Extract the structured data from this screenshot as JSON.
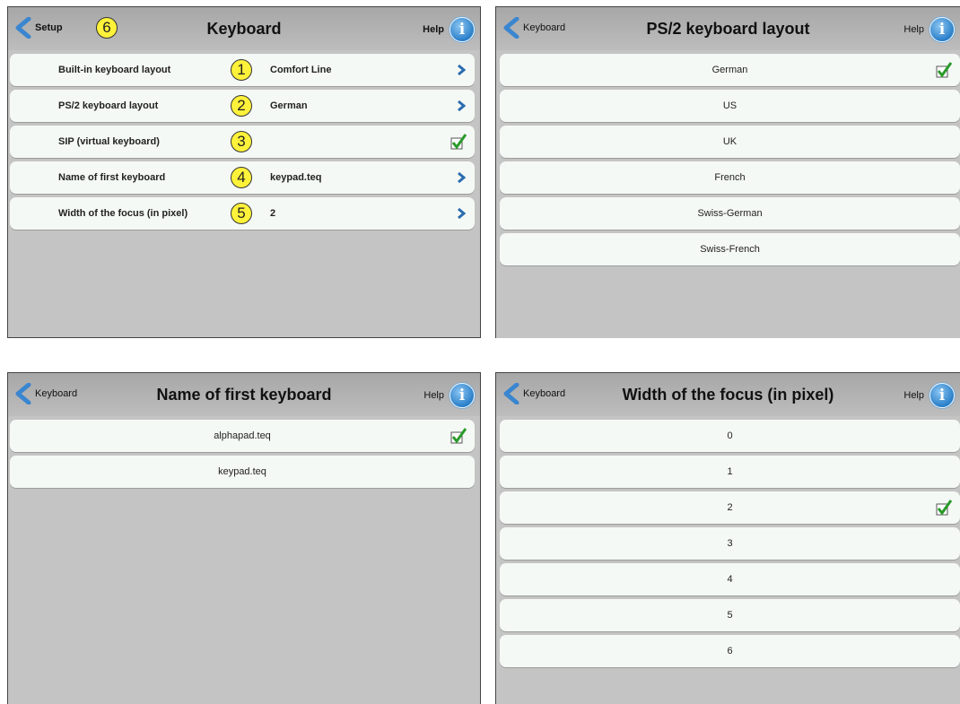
{
  "panel_main": {
    "back_label": "Setup",
    "title": "Keyboard",
    "help_label": "Help",
    "info_glyph": "i",
    "callout_back": "6",
    "rows": [
      {
        "label": "Built-in keyboard layout",
        "value": "Comfort Line",
        "callout": "1",
        "icon": "chevron-right-icon"
      },
      {
        "label": "PS/2 keyboard layout",
        "value": "German",
        "callout": "2",
        "icon": "chevron-right-icon"
      },
      {
        "label": "SIP (virtual keyboard)",
        "value": "",
        "callout": "3",
        "icon": "checkmark-icon"
      },
      {
        "label": "Name of first keyboard",
        "value": "keypad.teq",
        "callout": "4",
        "icon": "chevron-right-icon"
      },
      {
        "label": "Width of the focus (in pixel)",
        "value": "2",
        "callout": "5",
        "icon": "chevron-right-icon"
      }
    ]
  },
  "panel_ps2": {
    "back_label": "Keyboard",
    "title": "PS/2 keyboard layout",
    "help_label": "Help",
    "info_glyph": "i",
    "options": [
      "German",
      "US",
      "UK",
      "French",
      "Swiss-German",
      "Swiss-French"
    ],
    "selected": "German"
  },
  "panel_first": {
    "back_label": "Keyboard",
    "title": "Name of first keyboard",
    "help_label": "Help",
    "info_glyph": "i",
    "options": [
      "alphapad.teq",
      "keypad.teq"
    ],
    "selected": "alphapad.teq"
  },
  "panel_focus": {
    "back_label": "Keyboard",
    "title": "Width of the focus (in pixel)",
    "help_label": "Help",
    "info_glyph": "i",
    "options": [
      "0",
      "1",
      "2",
      "3",
      "4",
      "5",
      "6"
    ],
    "selected": "2"
  },
  "colors": {
    "panel_bg": "#c4c4c4",
    "row_bg": "#f5f9f5",
    "accent_blue": "#2a7fc9",
    "callout_yellow": "#fff23a",
    "check_green": "#2a9a2a"
  }
}
